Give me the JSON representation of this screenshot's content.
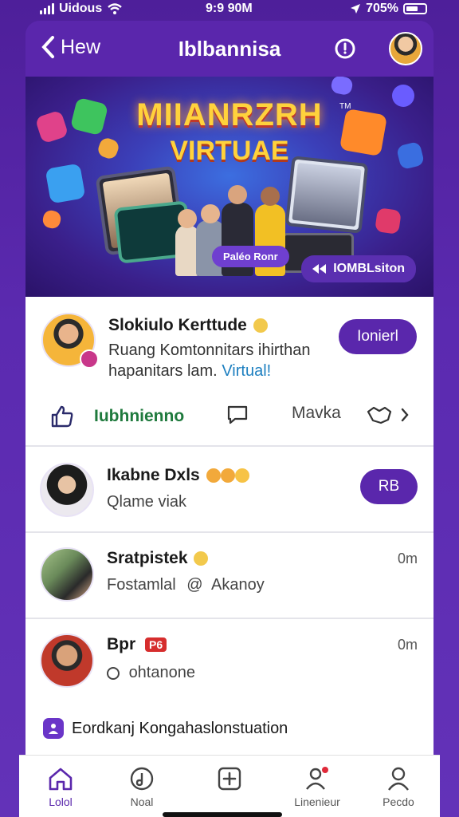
{
  "status_bar": {
    "carrier": "Uidous",
    "time": "9:9 90M",
    "battery": "705%"
  },
  "header": {
    "back_label": "Hew",
    "title": "Iblbannisa"
  },
  "banner": {
    "title": "MIIANRZRH",
    "subtitle": "VIRTUAE",
    "trademark": "TM",
    "chip": "Paléo Ronr",
    "tag": "IOMBLsiton"
  },
  "featured": {
    "name": "Slokiulo Kerttude",
    "description_line1": "Ruang Komtonnitars ihirthan",
    "description_line2": "hapanitars lam.",
    "description_link": "Virtual!",
    "join_label": "Ionierl",
    "actions": {
      "like_label": "Iubhnienno",
      "share_label": "Mavka"
    }
  },
  "list": [
    {
      "name": "Ikabne Dxls",
      "subtitle": "Qlame viak",
      "button_label": "RB",
      "time": ""
    },
    {
      "name": "Sratpistek",
      "subtitle": "Fostamlal",
      "subtitle_extra": "Akanoy",
      "time": "0m"
    },
    {
      "name": "Bpr",
      "badge": "P6",
      "subtitle": "ohtanone",
      "time": "0m"
    }
  ],
  "promo": {
    "text": "Eordkanj Kongahaslonstuation"
  },
  "bottom_nav": [
    {
      "label": "Lolol",
      "icon": "home-icon",
      "active": true
    },
    {
      "label": "Noal",
      "icon": "music-icon",
      "active": false
    },
    {
      "label": "",
      "icon": "add-icon",
      "active": false
    },
    {
      "label": "Linenieur",
      "icon": "person-notify-icon",
      "active": false
    },
    {
      "label": "Pecdo",
      "icon": "profile-icon",
      "active": false
    }
  ],
  "colors": {
    "brand_purple": "#5a27ac",
    "background": "#5b2ab0",
    "accent_green": "#1f7a3d",
    "link_blue": "#1d7fc0"
  }
}
